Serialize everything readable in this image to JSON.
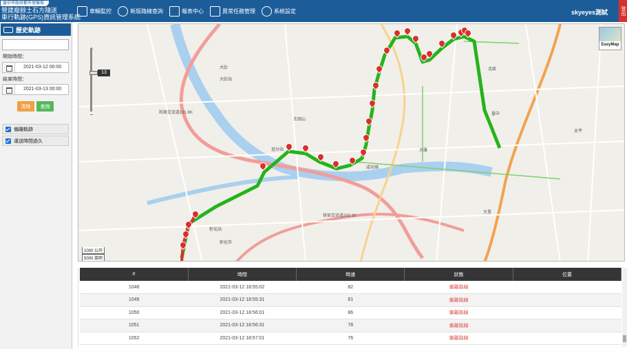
{
  "header": {
    "gov_tag": "臺中市政府都市發展局",
    "title_line1": "營建廢餘土石方隨送",
    "title_line2": "車行軌跡(GPS)資訊管理系統",
    "nav": [
      {
        "label": "車輛監控",
        "icon": "truck-monitor-icon"
      },
      {
        "label": "新版路線查詢",
        "icon": "route-search-icon"
      },
      {
        "label": "報表中心",
        "icon": "report-icon"
      },
      {
        "label": "異常任務管理",
        "icon": "alert-task-icon"
      },
      {
        "label": "系統設定",
        "icon": "gear-icon"
      }
    ],
    "user": "skyeyes測試",
    "logout": "登出"
  },
  "sidebar": {
    "title": "歷史軌跡",
    "search_value": "",
    "start_label": "開始時間：",
    "start_value": "2021-03-12 00:00",
    "end_label": "結束時間：",
    "end_value": "2021-03-13 00:00",
    "clear_label": "清除",
    "query_label": "查詢",
    "options": [
      "偏離軌跡",
      "運送時間過久"
    ]
  },
  "map": {
    "zoom_level": "13",
    "scale_km": "1000 公尺",
    "scale_ft": "5000 英呎",
    "easymap_label": "EasyMap",
    "places": [
      {
        "text": "大肚站",
        "color": "#555"
      },
      {
        "text": "和美交流道191.6K",
        "color": "#555"
      },
      {
        "text": "追分站",
        "color": "#555"
      },
      {
        "text": "王田山",
        "color": "#555"
      },
      {
        "text": "大肚",
        "color": "#555"
      },
      {
        "text": "彰化站",
        "color": "#555"
      },
      {
        "text": "彰化市",
        "color": "#555"
      },
      {
        "text": "快官交流道202.1K",
        "color": "#555"
      },
      {
        "text": "成功嶺",
        "color": "#555"
      },
      {
        "text": "大雅",
        "color": "#555"
      },
      {
        "text": "臺中",
        "color": "#555"
      },
      {
        "text": "北區",
        "color": "#555"
      },
      {
        "text": "大里",
        "color": "#555"
      },
      {
        "text": "太平",
        "color": "#555"
      }
    ]
  },
  "table": {
    "headers": [
      "#",
      "時間",
      "時速",
      "狀態",
      "位置"
    ],
    "rows": [
      {
        "num": "1048",
        "time": "2021-03-12 18:55:02",
        "speed": "82",
        "status": "偏離路線",
        "loc": ""
      },
      {
        "num": "1049",
        "time": "2021-03-12 18:55:31",
        "speed": "81",
        "status": "偏離路線",
        "loc": ""
      },
      {
        "num": "1050",
        "time": "2021-03-12 18:56:01",
        "speed": "86",
        "status": "偏離路線",
        "loc": ""
      },
      {
        "num": "1051",
        "time": "2021-03-12 18:56:31",
        "speed": "78",
        "status": "偏離路線",
        "loc": ""
      },
      {
        "num": "1052",
        "time": "2021-03-12 18:57:01",
        "speed": "76",
        "status": "偏離路線",
        "loc": ""
      }
    ]
  },
  "colors": {
    "brand": "#1c5d99",
    "track": "#25b31c",
    "marker": "#d9302c",
    "status": "#d9534f"
  }
}
